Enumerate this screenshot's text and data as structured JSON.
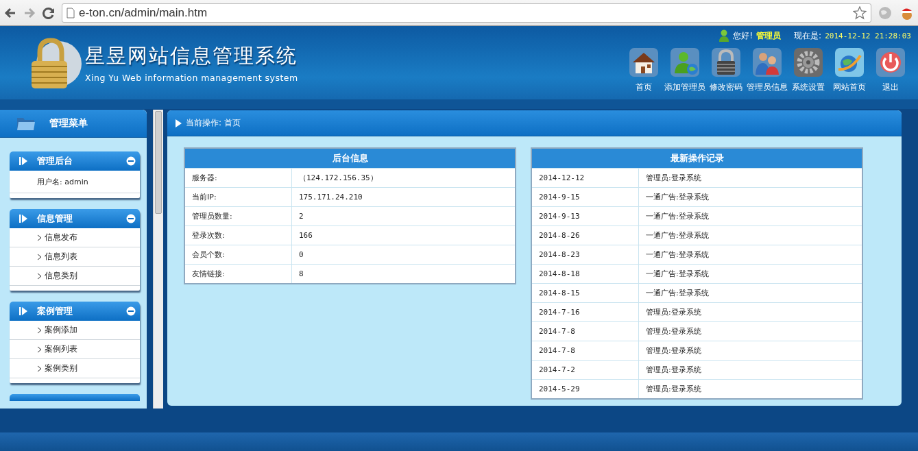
{
  "browser": {
    "url": "e-ton.cn/admin/main.htm"
  },
  "header": {
    "title": "星昱网站信息管理系统",
    "subtitle": "Xing Yu Web information management system",
    "greeting": "您好!",
    "user": "管理员",
    "time_label": "现在是:",
    "time": "2014-12-12 21:28:03",
    "nav": [
      {
        "label": "首页",
        "kind": "home"
      },
      {
        "label": "添加管理员",
        "kind": "add-admin"
      },
      {
        "label": "修改密码",
        "kind": "password"
      },
      {
        "label": "管理员信息",
        "kind": "admins"
      },
      {
        "label": "系统设置",
        "kind": "settings"
      },
      {
        "label": "网站首页",
        "kind": "site"
      },
      {
        "label": "退出",
        "kind": "logout"
      }
    ]
  },
  "sidebar": {
    "title": "管理菜单",
    "groups": [
      {
        "title": "管理后台",
        "expanded": true,
        "items": [
          {
            "label": "用户名: admin",
            "kind": "info"
          }
        ]
      },
      {
        "title": "信息管理",
        "expanded": true,
        "items": [
          {
            "label": "信息发布",
            "kind": "link"
          },
          {
            "label": "信息列表",
            "kind": "link"
          },
          {
            "label": "信息类别",
            "kind": "link"
          }
        ]
      },
      {
        "title": "案例管理",
        "expanded": true,
        "items": [
          {
            "label": "案例添加",
            "kind": "link"
          },
          {
            "label": "案例列表",
            "kind": "link"
          },
          {
            "label": "案例类别",
            "kind": "link"
          }
        ]
      }
    ]
  },
  "content": {
    "breadcrumb": "当前操作: 首页",
    "info_table": {
      "title": "后台信息",
      "rows": [
        {
          "label": "服务器:",
          "value": "（124.172.156.35）"
        },
        {
          "label": "当前IP:",
          "value": "175.171.24.210"
        },
        {
          "label": "管理员数量:",
          "value": "2"
        },
        {
          "label": "登录次数:",
          "value": "166"
        },
        {
          "label": "会员个数:",
          "value": "0"
        },
        {
          "label": "友情链接:",
          "value": "8"
        }
      ]
    },
    "log_table": {
      "title": "最新操作记录",
      "rows": [
        {
          "date": "2014-12-12",
          "action": "管理员:登录系统"
        },
        {
          "date": "2014-9-15",
          "action": "一通广告:登录系统"
        },
        {
          "date": "2014-9-13",
          "action": "一通广告:登录系统"
        },
        {
          "date": "2014-8-26",
          "action": "一通广告:登录系统"
        },
        {
          "date": "2014-8-23",
          "action": "一通广告:登录系统"
        },
        {
          "date": "2014-8-18",
          "action": "一通广告:登录系统"
        },
        {
          "date": "2014-8-15",
          "action": "一通广告:登录系统"
        },
        {
          "date": "2014-7-16",
          "action": "管理员:登录系统"
        },
        {
          "date": "2014-7-8",
          "action": "管理员:登录系统"
        },
        {
          "date": "2014-7-8",
          "action": "管理员:登录系统"
        },
        {
          "date": "2014-7-2",
          "action": "管理员:登录系统"
        },
        {
          "date": "2014-5-29",
          "action": "管理员:登录系统"
        }
      ]
    }
  }
}
